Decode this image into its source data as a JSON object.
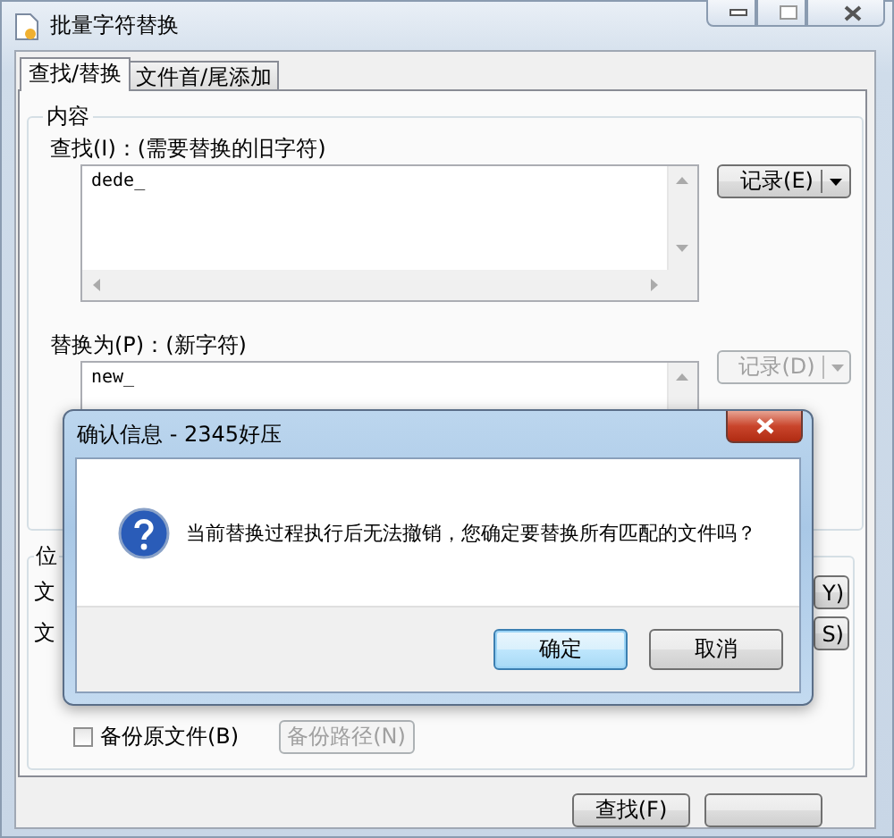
{
  "window": {
    "title": "批量字符替换"
  },
  "tabs": [
    {
      "label": "查找/替换",
      "selected": true
    },
    {
      "label": "文件首/尾添加",
      "selected": false
    }
  ],
  "content_group": {
    "title": "内容",
    "find": {
      "label": "查找(I)：(需要替换的旧字符)",
      "value": "dede_",
      "history_button": {
        "label": "记录(E)",
        "disabled": false
      }
    },
    "replace": {
      "label": "替换为(P)：(新字符)",
      "value": "new_",
      "history_button": {
        "label": "记录(D)",
        "disabled": true
      }
    }
  },
  "location_group": {
    "title": "位",
    "rows": [
      {
        "label": "文",
        "button": "Y)"
      },
      {
        "label": "文",
        "button": "S)"
      }
    ]
  },
  "backup": {
    "label": "备份原文件(B)",
    "checked": false,
    "path_button": {
      "label": "备份路径(N)",
      "disabled": true
    }
  },
  "footer_buttons": [
    {
      "kind": "text",
      "label": "查找(F)"
    },
    {
      "kind": "blank"
    }
  ],
  "dialog": {
    "title": "确认信息 - 2345好压",
    "message": "当前替换过程执行后无法撤销，您确定要替换所有匹配的文件吗？",
    "buttons": [
      {
        "label": "确定",
        "default": true
      },
      {
        "label": "取消",
        "default": false
      }
    ]
  }
}
